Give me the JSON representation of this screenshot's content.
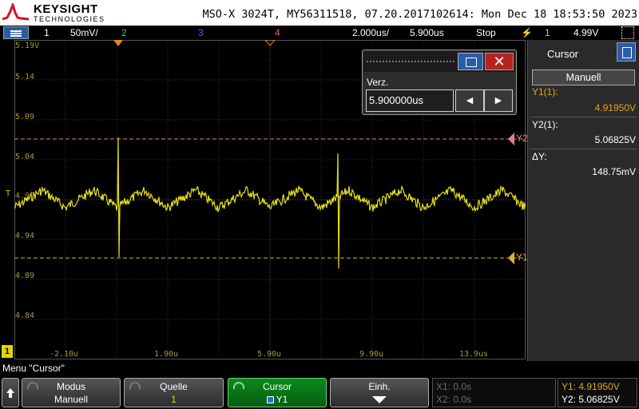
{
  "header": {
    "brand": "KEYSIGHT",
    "brand_sub": "TECHNOLOGIES",
    "instrument_info": "MSO-X 3024T, MY56311518, 07.20.2017102614: Mon Dec 18 18:53:50 2023"
  },
  "status_bar": {
    "channels": [
      {
        "label": "1",
        "color": "#ffffff"
      },
      {
        "label": "50mV/",
        "color": "#ffffff"
      },
      {
        "label": "2",
        "color": "#2fd32f"
      },
      {
        "label": "3",
        "color": "#4466ff"
      },
      {
        "label": "4",
        "color": "#ff3fa6"
      }
    ],
    "time_div": "2.000us/",
    "delay": "5.900us",
    "run_state": "Stop",
    "trigger_channel": "1",
    "trigger_level": "4.99V"
  },
  "plot": {
    "y_ticks": [
      "5.19V",
      "5.14",
      "5.09",
      "5.04",
      "4.99",
      "4.94",
      "4.89",
      "4.84"
    ],
    "x_ticks": [
      "-2.10u",
      "1.90u",
      "5.90u",
      "9.90u",
      "13.9us"
    ],
    "ground_marker": "1",
    "trigger_marker": "T",
    "cursor_y2_label": "Y2",
    "cursor_y1_label": "Y1",
    "trace_color": "#e6de1a",
    "cursor_y1_color": "#d7b432",
    "cursor_y2_color": "#e0857a"
  },
  "popup": {
    "label": "Verz.",
    "value": "5.900000us",
    "prev_symbol": "◀",
    "next_symbol": "▶",
    "close_symbol": "✕"
  },
  "right_panel": {
    "title": "Cursor",
    "mode_button": "Manuell",
    "y1_label": "Y1(1):",
    "y1_value": "4.91950V",
    "y2_label": "Y2(1):",
    "y2_value": "5.06825V",
    "dy_label": "ΔY:",
    "dy_value": "148.75mV"
  },
  "menu_title": "Menu \"Cursor\"",
  "softkeys": {
    "modus": {
      "line1": "Modus",
      "line2": "Manuell"
    },
    "quelle": {
      "line1": "Quelle",
      "line2": "1"
    },
    "cursor": {
      "line1": "Cursor",
      "line2": "Y1"
    },
    "einh": {
      "line1": "Einh."
    }
  },
  "readouts": {
    "x1": "X1: 0.0s",
    "x2": "X2: 0.0s",
    "y1": "Y1: 4.91950V",
    "y2": "Y2: 5.06825V"
  }
}
